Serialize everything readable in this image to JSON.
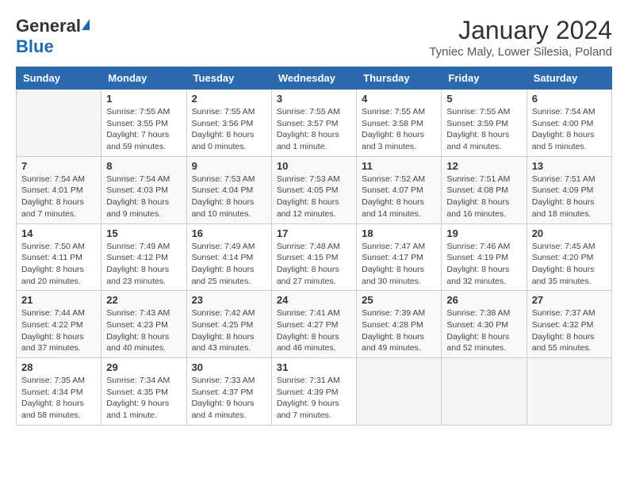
{
  "header": {
    "logo_general": "General",
    "logo_blue": "Blue",
    "title": "January 2024",
    "subtitle": "Tyniec Maly, Lower Silesia, Poland"
  },
  "days_of_week": [
    "Sunday",
    "Monday",
    "Tuesday",
    "Wednesday",
    "Thursday",
    "Friday",
    "Saturday"
  ],
  "weeks": [
    [
      {
        "day": "",
        "info": ""
      },
      {
        "day": "1",
        "info": "Sunrise: 7:55 AM\nSunset: 3:55 PM\nDaylight: 7 hours\nand 59 minutes."
      },
      {
        "day": "2",
        "info": "Sunrise: 7:55 AM\nSunset: 3:56 PM\nDaylight: 8 hours\nand 0 minutes."
      },
      {
        "day": "3",
        "info": "Sunrise: 7:55 AM\nSunset: 3:57 PM\nDaylight: 8 hours\nand 1 minute."
      },
      {
        "day": "4",
        "info": "Sunrise: 7:55 AM\nSunset: 3:58 PM\nDaylight: 8 hours\nand 3 minutes."
      },
      {
        "day": "5",
        "info": "Sunrise: 7:55 AM\nSunset: 3:59 PM\nDaylight: 8 hours\nand 4 minutes."
      },
      {
        "day": "6",
        "info": "Sunrise: 7:54 AM\nSunset: 4:00 PM\nDaylight: 8 hours\nand 5 minutes."
      }
    ],
    [
      {
        "day": "7",
        "info": "Sunrise: 7:54 AM\nSunset: 4:01 PM\nDaylight: 8 hours\nand 7 minutes."
      },
      {
        "day": "8",
        "info": "Sunrise: 7:54 AM\nSunset: 4:03 PM\nDaylight: 8 hours\nand 9 minutes."
      },
      {
        "day": "9",
        "info": "Sunrise: 7:53 AM\nSunset: 4:04 PM\nDaylight: 8 hours\nand 10 minutes."
      },
      {
        "day": "10",
        "info": "Sunrise: 7:53 AM\nSunset: 4:05 PM\nDaylight: 8 hours\nand 12 minutes."
      },
      {
        "day": "11",
        "info": "Sunrise: 7:52 AM\nSunset: 4:07 PM\nDaylight: 8 hours\nand 14 minutes."
      },
      {
        "day": "12",
        "info": "Sunrise: 7:51 AM\nSunset: 4:08 PM\nDaylight: 8 hours\nand 16 minutes."
      },
      {
        "day": "13",
        "info": "Sunrise: 7:51 AM\nSunset: 4:09 PM\nDaylight: 8 hours\nand 18 minutes."
      }
    ],
    [
      {
        "day": "14",
        "info": "Sunrise: 7:50 AM\nSunset: 4:11 PM\nDaylight: 8 hours\nand 20 minutes."
      },
      {
        "day": "15",
        "info": "Sunrise: 7:49 AM\nSunset: 4:12 PM\nDaylight: 8 hours\nand 23 minutes."
      },
      {
        "day": "16",
        "info": "Sunrise: 7:49 AM\nSunset: 4:14 PM\nDaylight: 8 hours\nand 25 minutes."
      },
      {
        "day": "17",
        "info": "Sunrise: 7:48 AM\nSunset: 4:15 PM\nDaylight: 8 hours\nand 27 minutes."
      },
      {
        "day": "18",
        "info": "Sunrise: 7:47 AM\nSunset: 4:17 PM\nDaylight: 8 hours\nand 30 minutes."
      },
      {
        "day": "19",
        "info": "Sunrise: 7:46 AM\nSunset: 4:19 PM\nDaylight: 8 hours\nand 32 minutes."
      },
      {
        "day": "20",
        "info": "Sunrise: 7:45 AM\nSunset: 4:20 PM\nDaylight: 8 hours\nand 35 minutes."
      }
    ],
    [
      {
        "day": "21",
        "info": "Sunrise: 7:44 AM\nSunset: 4:22 PM\nDaylight: 8 hours\nand 37 minutes."
      },
      {
        "day": "22",
        "info": "Sunrise: 7:43 AM\nSunset: 4:23 PM\nDaylight: 8 hours\nand 40 minutes."
      },
      {
        "day": "23",
        "info": "Sunrise: 7:42 AM\nSunset: 4:25 PM\nDaylight: 8 hours\nand 43 minutes."
      },
      {
        "day": "24",
        "info": "Sunrise: 7:41 AM\nSunset: 4:27 PM\nDaylight: 8 hours\nand 46 minutes."
      },
      {
        "day": "25",
        "info": "Sunrise: 7:39 AM\nSunset: 4:28 PM\nDaylight: 8 hours\nand 49 minutes."
      },
      {
        "day": "26",
        "info": "Sunrise: 7:38 AM\nSunset: 4:30 PM\nDaylight: 8 hours\nand 52 minutes."
      },
      {
        "day": "27",
        "info": "Sunrise: 7:37 AM\nSunset: 4:32 PM\nDaylight: 8 hours\nand 55 minutes."
      }
    ],
    [
      {
        "day": "28",
        "info": "Sunrise: 7:35 AM\nSunset: 4:34 PM\nDaylight: 8 hours\nand 58 minutes."
      },
      {
        "day": "29",
        "info": "Sunrise: 7:34 AM\nSunset: 4:35 PM\nDaylight: 9 hours\nand 1 minute."
      },
      {
        "day": "30",
        "info": "Sunrise: 7:33 AM\nSunset: 4:37 PM\nDaylight: 9 hours\nand 4 minutes."
      },
      {
        "day": "31",
        "info": "Sunrise: 7:31 AM\nSunset: 4:39 PM\nDaylight: 9 hours\nand 7 minutes."
      },
      {
        "day": "",
        "info": ""
      },
      {
        "day": "",
        "info": ""
      },
      {
        "day": "",
        "info": ""
      }
    ]
  ]
}
